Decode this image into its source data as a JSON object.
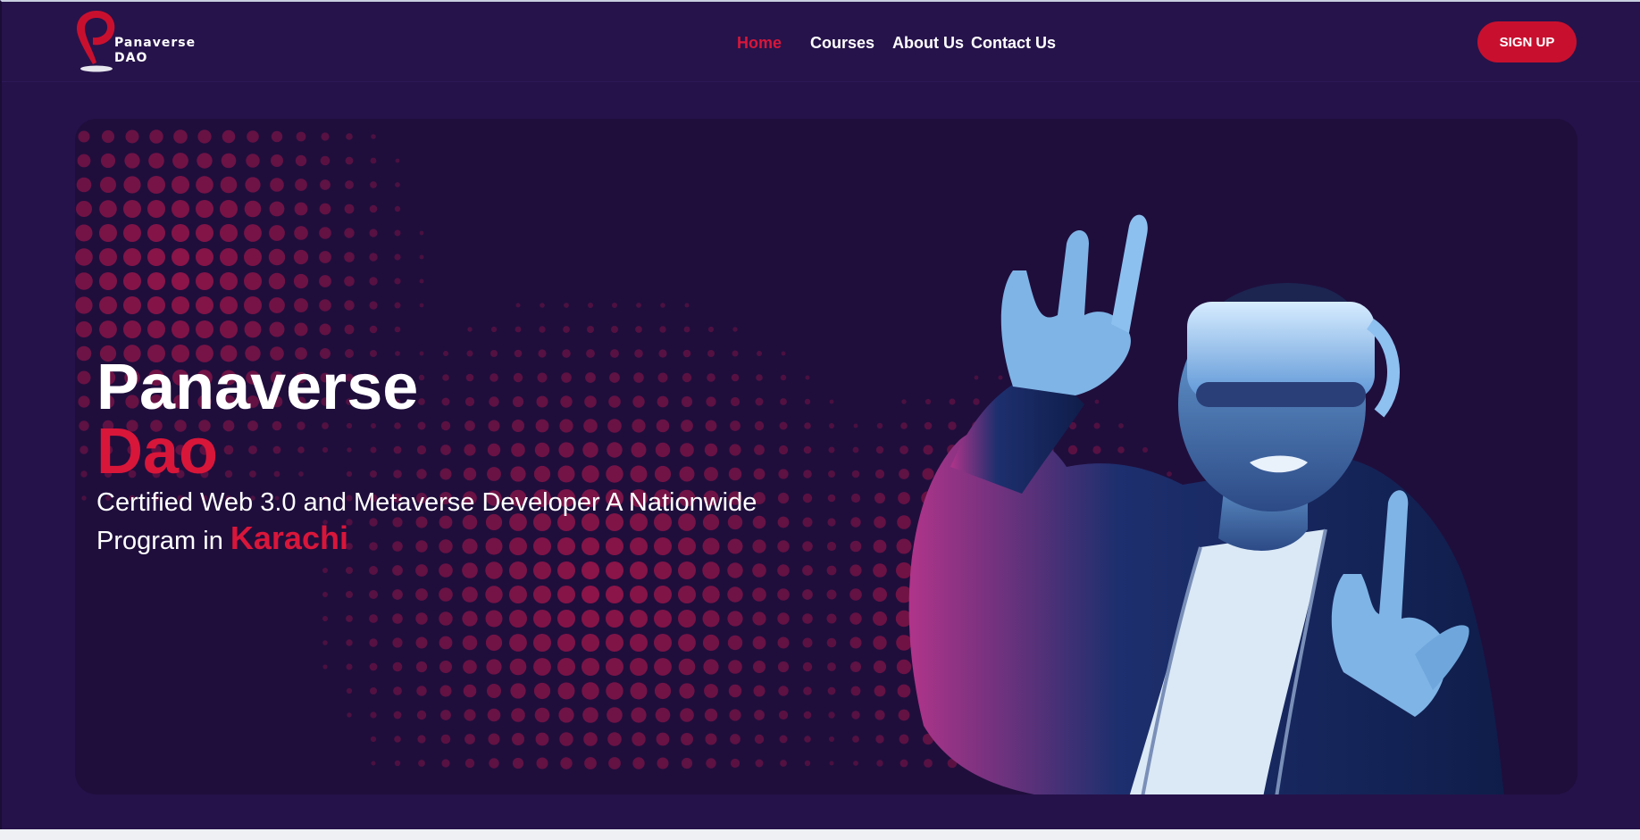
{
  "brand": {
    "line1": "Panaverse",
    "line2": "DAO",
    "accent": "#c8102e"
  },
  "nav": {
    "items": [
      {
        "label": "Home",
        "active": true
      },
      {
        "label": "Courses",
        "active": false
      },
      {
        "label": "About Us",
        "active": false
      },
      {
        "label": "Contact Us",
        "active": false
      }
    ],
    "signup_label": "SIGN UP"
  },
  "hero": {
    "title_line1": "Panaverse",
    "title_line2": "Dao",
    "subtitle_prefix": "Certified Web 3.0 and Metaverse Developer A Nationwide Program in ",
    "subtitle_city": "Karachi",
    "image_icon": "vr-headset-person-illustration"
  },
  "colors": {
    "page_background": "#25124a",
    "hero_background": "#1f0e3c",
    "accent_red": "#d8163a",
    "text": "#ffffff"
  }
}
